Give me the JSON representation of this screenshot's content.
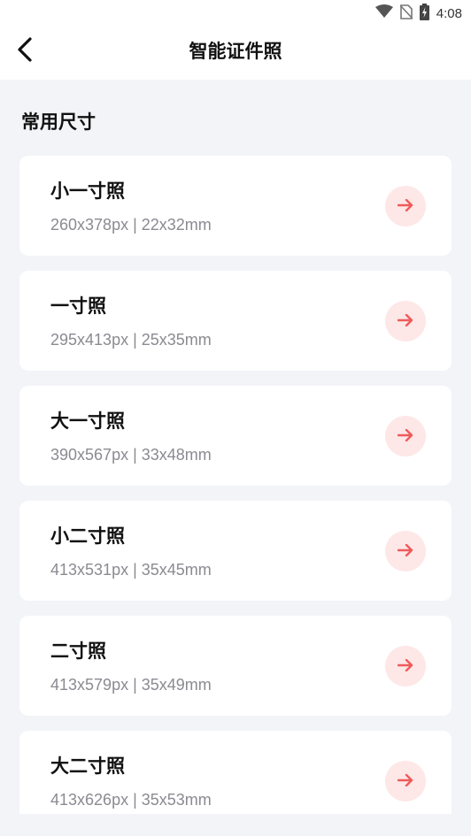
{
  "status_bar": {
    "time": "4:08",
    "icons": [
      "wifi-icon",
      "no-sim-icon",
      "battery-charging-icon"
    ]
  },
  "header": {
    "title": "智能证件照",
    "back_icon": "chevron-left-icon"
  },
  "section": {
    "title": "常用尺寸"
  },
  "sizes": [
    {
      "name": "小一寸照",
      "spec": "260x378px | 22x32mm"
    },
    {
      "name": "一寸照",
      "spec": "295x413px | 25x35mm"
    },
    {
      "name": "大一寸照",
      "spec": "390x567px | 33x48mm"
    },
    {
      "name": "小二寸照",
      "spec": "413x531px | 35x45mm"
    },
    {
      "name": "二寸照",
      "spec": "413x579px | 35x49mm"
    },
    {
      "name": "大二寸照",
      "spec": "413x626px | 35x53mm"
    }
  ],
  "colors": {
    "accent": "#f05a5a",
    "accent_bg": "#fde7e7",
    "page_bg": "#f3f4f8"
  }
}
